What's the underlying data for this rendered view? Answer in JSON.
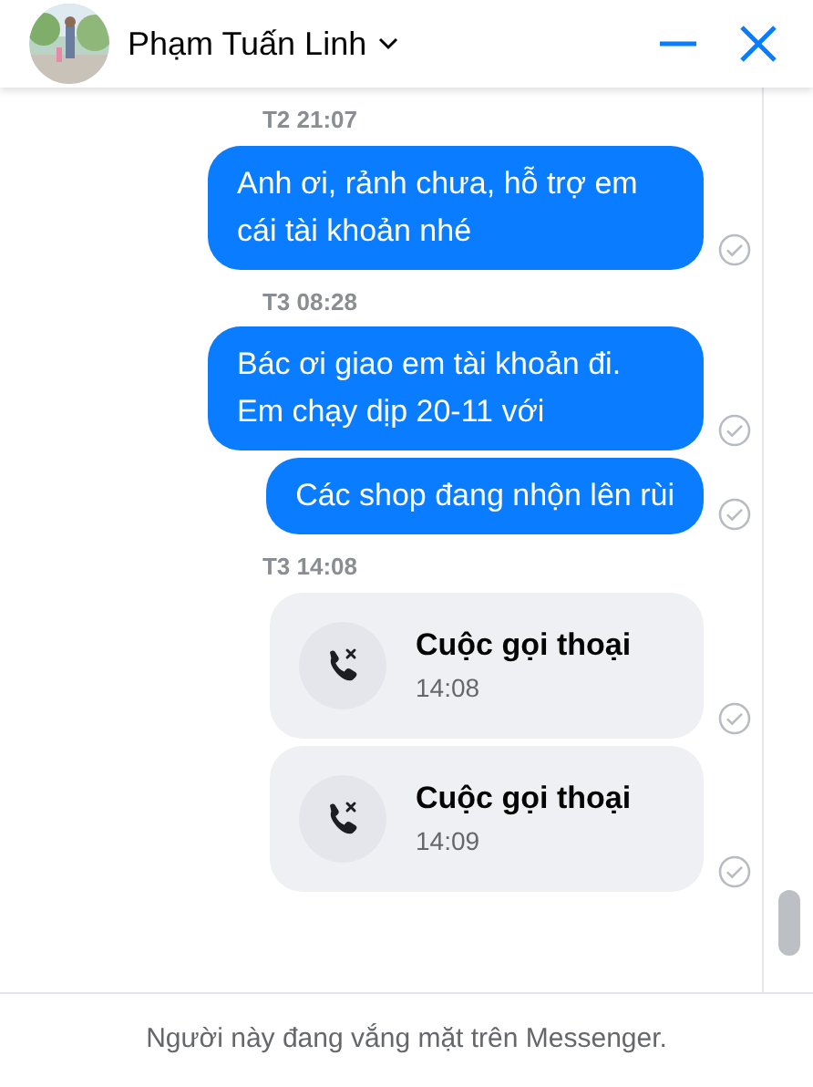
{
  "header": {
    "name": "Phạm Tuấn Linh"
  },
  "messages": [
    {
      "kind": "timestamp",
      "text": "T2 21:07"
    },
    {
      "kind": "text",
      "text": "Anh ơi, rảnh chưa, hỗ trợ em cái tài khoản nhé",
      "read": true
    },
    {
      "kind": "timestamp",
      "text": "T3 08:28"
    },
    {
      "kind": "text",
      "text": "Bác ơi giao em tài khoản đi. Em chạy dịp 20-11 với",
      "read": true
    },
    {
      "kind": "text",
      "text": "Các shop đang nhộn lên rùi",
      "read": true
    },
    {
      "kind": "timestamp",
      "text": "T3 14:08"
    },
    {
      "kind": "call",
      "title": "Cuộc gọi thoại",
      "time": "14:08",
      "read": true
    },
    {
      "kind": "call",
      "title": "Cuộc gọi thoại",
      "time": "14:09",
      "read": true
    }
  ],
  "footer": {
    "text": "Người này đang vắng mặt trên Messenger."
  }
}
